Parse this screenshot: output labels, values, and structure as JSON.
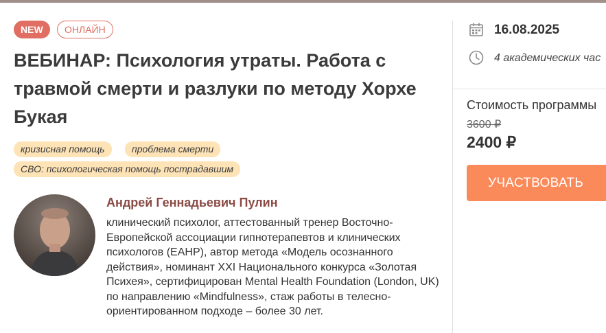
{
  "badges": {
    "new": "NEW",
    "online": "ОНЛАЙН"
  },
  "title": "ВЕБИНАР: Психология утраты. Работа с травмой смерти и разлуки по методу Хорхе Букая",
  "tags": [
    "кризисная помощь",
    "проблема смерти",
    "СВО: психологическая помощь пострадавшим"
  ],
  "author": {
    "name": "Андрей Геннадьевич Пулин",
    "description": "клинический психолог, аттестованный тренер Восточно-Европейской ассоциации гипнотерапевтов и клинических психологов (EAHP), автор метода «Модель осознанного действия», номинант XXI Национального конкурса «Золотая Психея», сертифицирован Mental Health Foundation (London, UK) по направлению «Mindfulness», стаж работы в телесно-ориентированном подходе – более 30 лет."
  },
  "sidebar": {
    "date": "16.08.2025",
    "duration": "4 академических час",
    "price_label": "Стоимость программы",
    "old_price": "3600 ₽",
    "new_price": "2400 ₽",
    "cta_label": "УЧАСТВОВАТЬ"
  },
  "colors": {
    "accent": "#e06e62",
    "cta": "#fb8a5a",
    "tag_bg": "#fde3b6",
    "author_name": "#8a4b45"
  },
  "icons": {
    "date": "calendar-icon",
    "duration": "clock-icon"
  }
}
